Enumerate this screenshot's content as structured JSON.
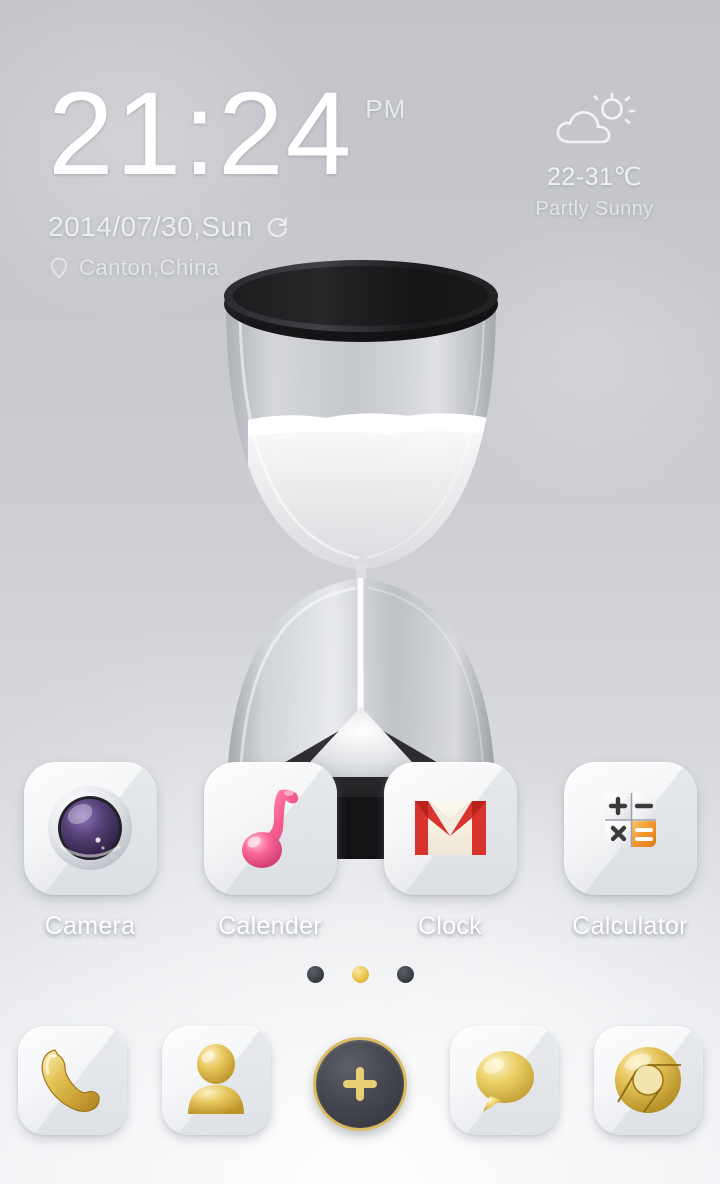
{
  "clock": {
    "time": "21:24",
    "ampm": "PM",
    "date": "2014/07/30,Sun",
    "location": "Canton,China",
    "refresh_icon": "refresh-icon",
    "location_icon": "location-pin-icon"
  },
  "weather": {
    "icon": "sun-behind-cloud-icon",
    "temperature": "22-31℃",
    "condition": "Partly Sunny"
  },
  "wallpaper": {
    "subject": "hourglass",
    "cap_color": "#1d1d1f",
    "glass_color": "#b9bcc2",
    "sand_color": "#f4f5f6"
  },
  "apps": [
    {
      "label": "Camera",
      "icon": "camera-lens-icon"
    },
    {
      "label": "Calender",
      "icon": "pink-note-icon"
    },
    {
      "label": "Clock",
      "icon": "envelope-mail-icon"
    },
    {
      "label": "Calculator",
      "icon": "calculator-keys-icon"
    }
  ],
  "page_indicator": {
    "count": 3,
    "active_index": 1,
    "active_color": "#e8bf45",
    "inactive_color": "#3b3e44"
  },
  "dock": [
    {
      "label": "Phone",
      "icon": "phone-handset-icon"
    },
    {
      "label": "Contacts",
      "icon": "person-icon"
    },
    {
      "label": "App Drawer",
      "icon": "plus-icon"
    },
    {
      "label": "Messages",
      "icon": "speech-bubble-icon"
    },
    {
      "label": "Browser",
      "icon": "chrome-browser-icon"
    }
  ],
  "theme": {
    "accent_gold": "#d9b957",
    "background_top": "#c3c5ca",
    "background_bottom": "#eff1f4",
    "label_color": "#ffffff"
  }
}
